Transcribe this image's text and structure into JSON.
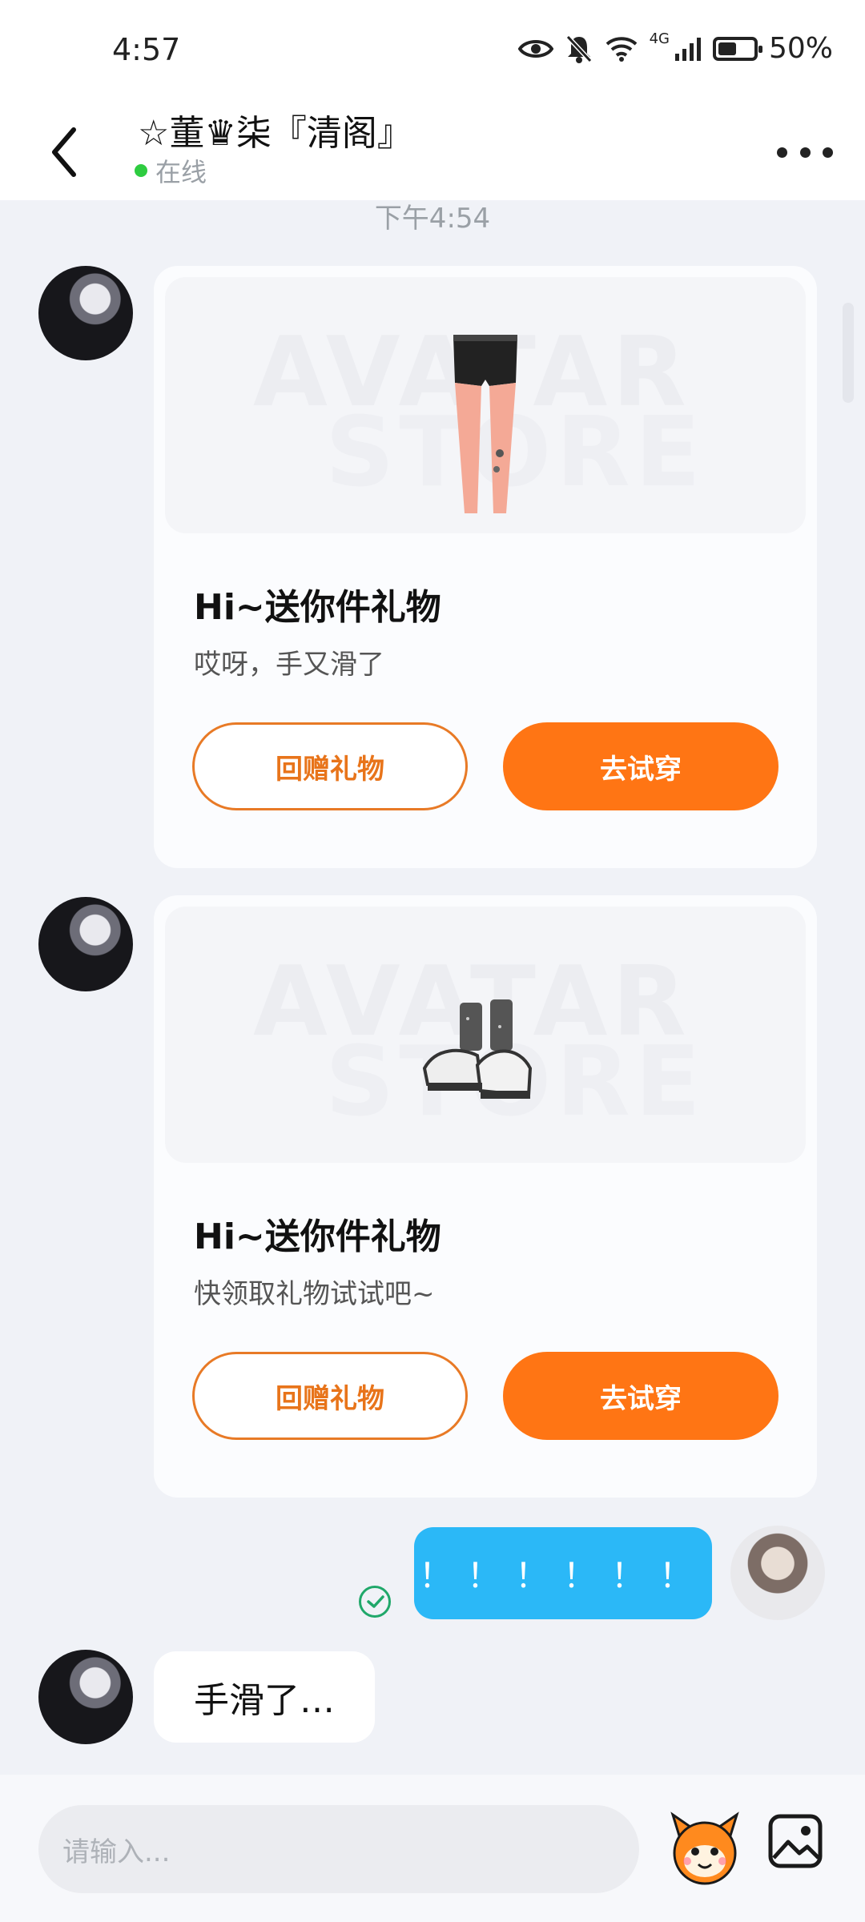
{
  "status_bar": {
    "time": "4:57",
    "battery": "50%",
    "network": "4G"
  },
  "header": {
    "title": "☆董♛柒『清阁』",
    "status": "在线"
  },
  "timestamp": "下午4:54",
  "cards": [
    {
      "title": "Hi~送你件礼物",
      "subtitle": "哎呀，手又滑了",
      "btn_return": "回赠礼物",
      "btn_try": "去试穿",
      "watermark_1": "AVATAR",
      "watermark_2": "STORE",
      "item": "leggings"
    },
    {
      "title": "Hi~送你件礼物",
      "subtitle": "快领取礼物试试吧~",
      "btn_return": "回赠礼物",
      "btn_try": "去试穿",
      "watermark_1": "AVATAR",
      "watermark_2": "STORE",
      "item": "sneakers"
    }
  ],
  "my_message": "！！！！！！",
  "their_message": "手滑了…",
  "composer": {
    "placeholder": "请输入..."
  },
  "colors": {
    "accent": "#ff7514",
    "bubble": "#2bb8f7",
    "online": "#2ecc40"
  }
}
